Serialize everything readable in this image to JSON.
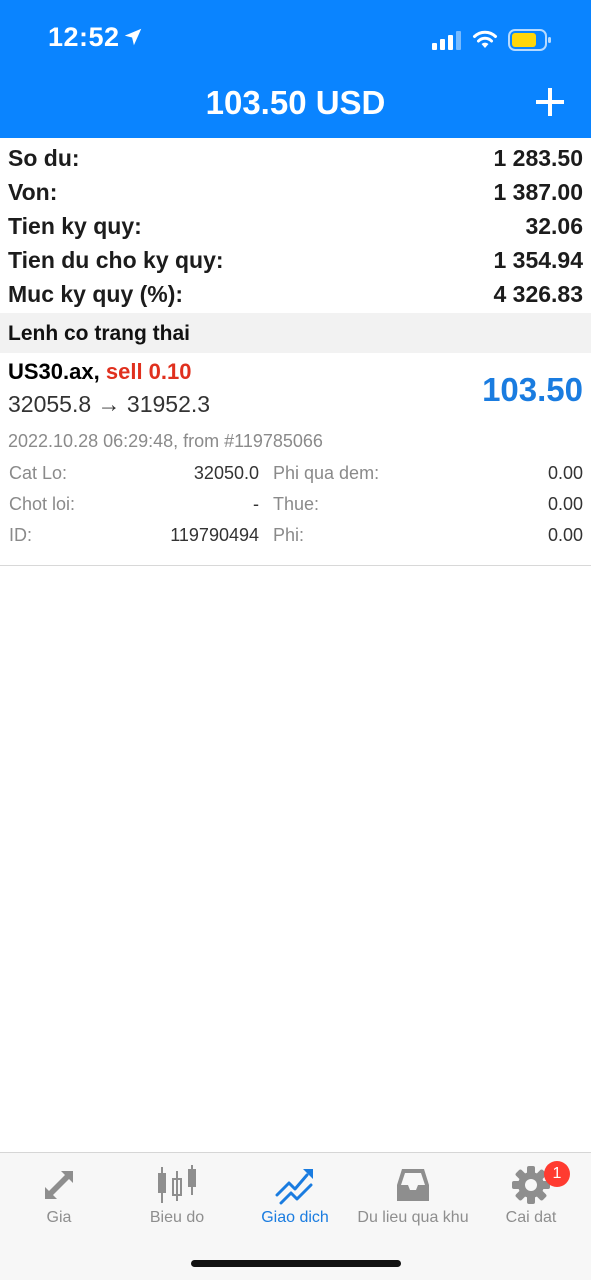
{
  "status_bar": {
    "time": "12:52"
  },
  "header": {
    "title": "103.50 USD",
    "add_icon": "plus-icon"
  },
  "summary": [
    {
      "label": "So du:",
      "value": "1 283.50"
    },
    {
      "label": "Von:",
      "value": "1 387.00"
    },
    {
      "label": "Tien ky quy:",
      "value": "32.06"
    },
    {
      "label": "Tien du cho ky quy:",
      "value": "1 354.94"
    },
    {
      "label": "Muc ky quy (%):",
      "value": "4 326.83"
    }
  ],
  "section_title": "Lenh co trang thai",
  "position": {
    "symbol": "US30.ax,",
    "side": "sell 0.10",
    "prices": "32055.8 → 31952.3",
    "profit": "103.50",
    "time": "2022.10.28 06:29:48, from #119785066",
    "details": [
      {
        "label1": "Cat Lo:",
        "value1": "32050.0",
        "label2": "Phi qua dem:",
        "value2": "0.00"
      },
      {
        "label1": "Chot loi:",
        "value1": "-",
        "label2": "Thue:",
        "value2": "0.00"
      },
      {
        "label1": "ID:",
        "value1": "119790494",
        "label2": "Phi:",
        "value2": "0.00"
      }
    ]
  },
  "tabs": [
    {
      "label": "Gia",
      "icon": "quotes-arrows-icon"
    },
    {
      "label": "Bieu do",
      "icon": "candlestick-icon"
    },
    {
      "label": "Giao dich",
      "icon": "trade-chart-icon"
    },
    {
      "label": "Du lieu qua khu",
      "icon": "inbox-icon"
    },
    {
      "label": "Cai dat",
      "icon": "gear-icon"
    }
  ],
  "badge": "1",
  "colors": {
    "accent": "#0a84ff",
    "sell": "#e0301e",
    "profit": "#1a7ce0",
    "badge": "#ff3b30"
  }
}
